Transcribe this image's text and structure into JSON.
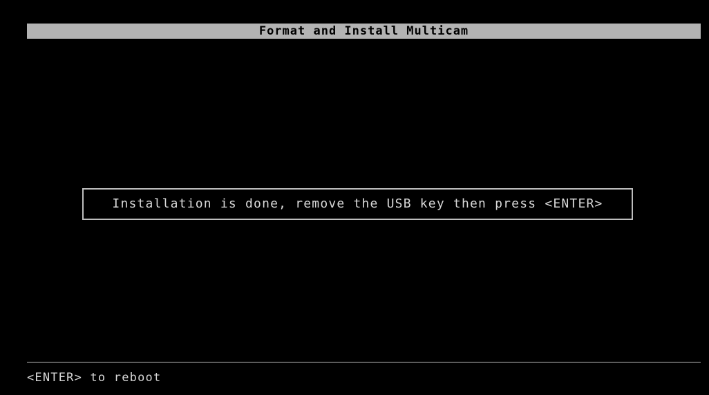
{
  "screen": {
    "title": "Format and Install Multicam",
    "dialog": {
      "message": "Installation is done, remove the USB key then press <ENTER>"
    },
    "hint": "<ENTER> to reboot"
  }
}
